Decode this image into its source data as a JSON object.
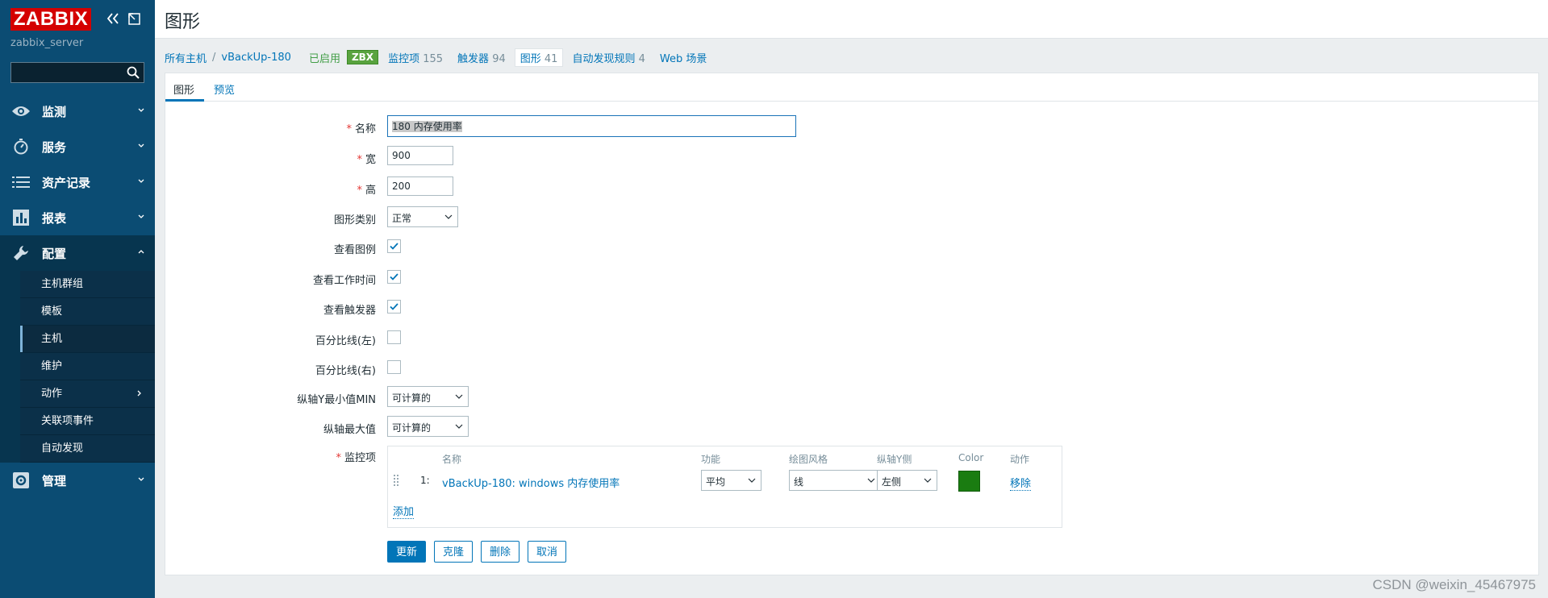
{
  "sidebar": {
    "logo": "ZABBIX",
    "server_name": "zabbix_server",
    "search_placeholder": "",
    "menu": [
      {
        "label": "监测",
        "icon": "eye-icon"
      },
      {
        "label": "服务",
        "icon": "stopwatch-icon"
      },
      {
        "label": "资产记录",
        "icon": "list-icon"
      },
      {
        "label": "报表",
        "icon": "bar-chart-icon"
      },
      {
        "label": "配置",
        "icon": "wrench-icon"
      },
      {
        "label": "管理",
        "icon": "gear-icon"
      }
    ],
    "config_submenu": [
      "主机群组",
      "模板",
      "主机",
      "维护",
      "动作",
      "关联项事件",
      "自动发现"
    ]
  },
  "header": {
    "title": "图形"
  },
  "breadcrumbs": {
    "all_hosts": "所有主机",
    "separator": "/",
    "host": "vBackUp-180",
    "status": "已启用",
    "badge": "ZBX",
    "tabs": [
      {
        "label": "监控项",
        "count": "155"
      },
      {
        "label": "触发器",
        "count": "94"
      },
      {
        "label": "图形",
        "count": "41"
      },
      {
        "label": "自动发现规则",
        "count": "4"
      },
      {
        "label": "Web 场景",
        "count": ""
      }
    ]
  },
  "form_tabs": {
    "graph": "图形",
    "preview": "预览"
  },
  "form": {
    "name_label": "名称",
    "name_value": "180 内存使用率",
    "width_label": "宽",
    "width_value": "900",
    "height_label": "高",
    "height_value": "200",
    "type_label": "图形类别",
    "type_value": "正常",
    "show_legend_label": "查看图例",
    "show_worktime_label": "查看工作时间",
    "show_triggers_label": "查看触发器",
    "percent_left_label": "百分比线(左)",
    "percent_right_label": "百分比线(右)",
    "ymin_label": "纵轴Y最小值MIN",
    "ymin_value": "可计算的",
    "ymax_label": "纵轴最大值",
    "ymax_value": "可计算的",
    "items_label": "监控项",
    "required_mark": "*"
  },
  "items_table": {
    "headers": {
      "name": "名称",
      "function": "功能",
      "draw_style": "绘图风格",
      "y_axis_side": "纵轴Y侧",
      "color": "Color",
      "action": "动作"
    },
    "rows": [
      {
        "num": "1:",
        "name": "vBackUp-180: windows 内存使用率",
        "function": "平均",
        "draw_style": "线",
        "y_axis_side": "左侧",
        "color": "#1A7C11",
        "action": "移除"
      }
    ],
    "add_label": "添加"
  },
  "buttons": {
    "update": "更新",
    "clone": "克隆",
    "delete": "删除",
    "cancel": "取消"
  },
  "watermark": "CSDN @weixin_45467975"
}
